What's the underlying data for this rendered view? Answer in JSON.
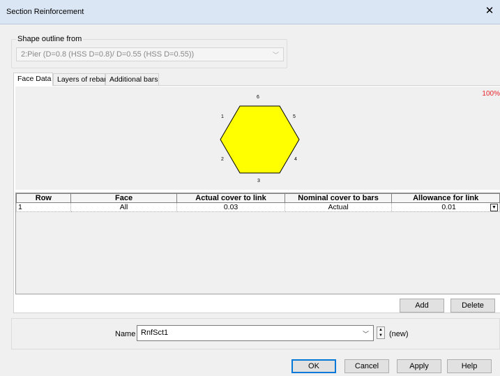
{
  "window": {
    "title": "Section Reinforcement",
    "close_glyph": "✕"
  },
  "shape_outline": {
    "legend": "Shape outline from",
    "value": "2:Pier (D=0.8 (HSS D=0.8)/ D=0.55 (HSS D=0.55))"
  },
  "tabs": [
    {
      "label": "Face Data",
      "active": true
    },
    {
      "label": "Layers of rebar",
      "active": false
    },
    {
      "label": "Additional bars",
      "active": false
    }
  ],
  "preview": {
    "zoom": "100%",
    "fill_color": "#ffff00",
    "face_labels": [
      "1",
      "2",
      "3",
      "4",
      "5",
      "6"
    ]
  },
  "grid": {
    "columns": [
      "Row",
      "Face",
      "Actual cover to link",
      "Nominal cover to bars",
      "Allowance for link"
    ],
    "rows": [
      {
        "row": "1",
        "face": "All",
        "actual_cover": "0.03",
        "nominal_cover": "Actual",
        "allowance": "0.01"
      }
    ]
  },
  "grid_buttons": {
    "add": "Add",
    "delete": "Delete"
  },
  "name_field": {
    "label": "Name",
    "value": "RnfSct1",
    "status": "(new)"
  },
  "footer": {
    "ok": "OK",
    "cancel": "Cancel",
    "apply": "Apply",
    "help": "Help"
  }
}
